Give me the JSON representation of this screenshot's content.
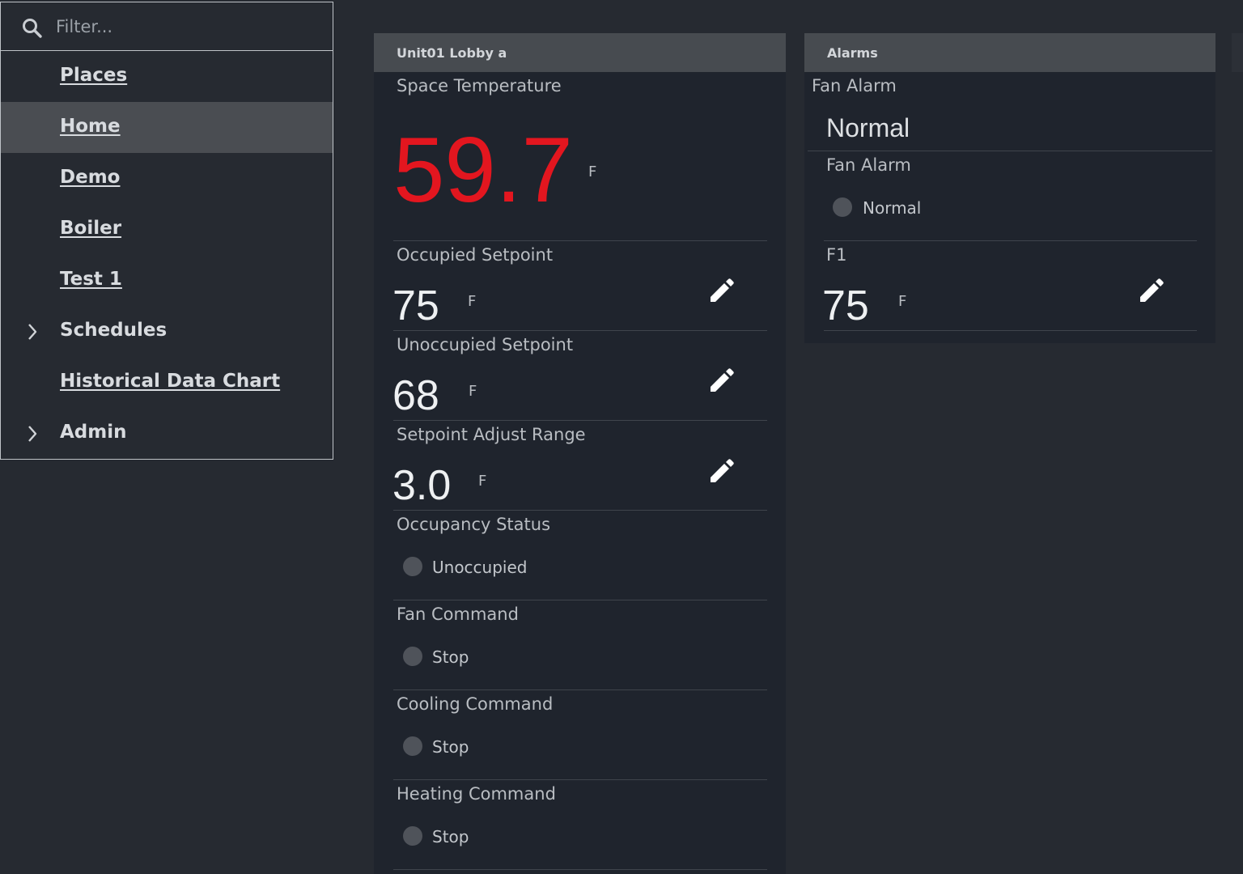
{
  "sidebar": {
    "filter_placeholder": "Filter...",
    "items": [
      {
        "label": "Places"
      },
      {
        "label": "Home"
      },
      {
        "label": "Demo"
      },
      {
        "label": "Boiler"
      },
      {
        "label": "Test 1"
      },
      {
        "label": "Schedules"
      },
      {
        "label": "Historical Data Chart"
      },
      {
        "label": "Admin"
      }
    ]
  },
  "unit_panel": {
    "title": "Unit01 Lobby a",
    "space_temp": {
      "label": "Space Temperature",
      "value": "59.7",
      "unit": "F",
      "value_color": "#e3161f"
    },
    "occupied_setpoint": {
      "label": "Occupied Setpoint",
      "value": "75",
      "unit": "F"
    },
    "unoccupied_setpoint": {
      "label": "Unoccupied Setpoint",
      "value": "68",
      "unit": "F"
    },
    "setpoint_adjust_range": {
      "label": "Setpoint Adjust Range",
      "value": "3.0",
      "unit": "F"
    },
    "occupancy_status": {
      "label": "Occupancy Status",
      "status": "Unoccupied"
    },
    "fan_command": {
      "label": "Fan Command",
      "status": "Stop"
    },
    "cooling_command": {
      "label": "Cooling Command",
      "status": "Stop"
    },
    "heating_command": {
      "label": "Heating Command",
      "status": "Stop"
    }
  },
  "alarms_panel": {
    "title": "Alarms",
    "fan_alarm_text": {
      "label": "Fan Alarm",
      "value": "Normal"
    },
    "fan_alarm_status": {
      "label": "Fan Alarm",
      "status": "Normal"
    },
    "f1": {
      "label": "F1",
      "value": "75",
      "unit": "F"
    }
  },
  "icons": {
    "filter": "search-icon",
    "expand": "chevron-right-icon",
    "edit": "pencil-icon",
    "status": "status-indicator-icon"
  }
}
